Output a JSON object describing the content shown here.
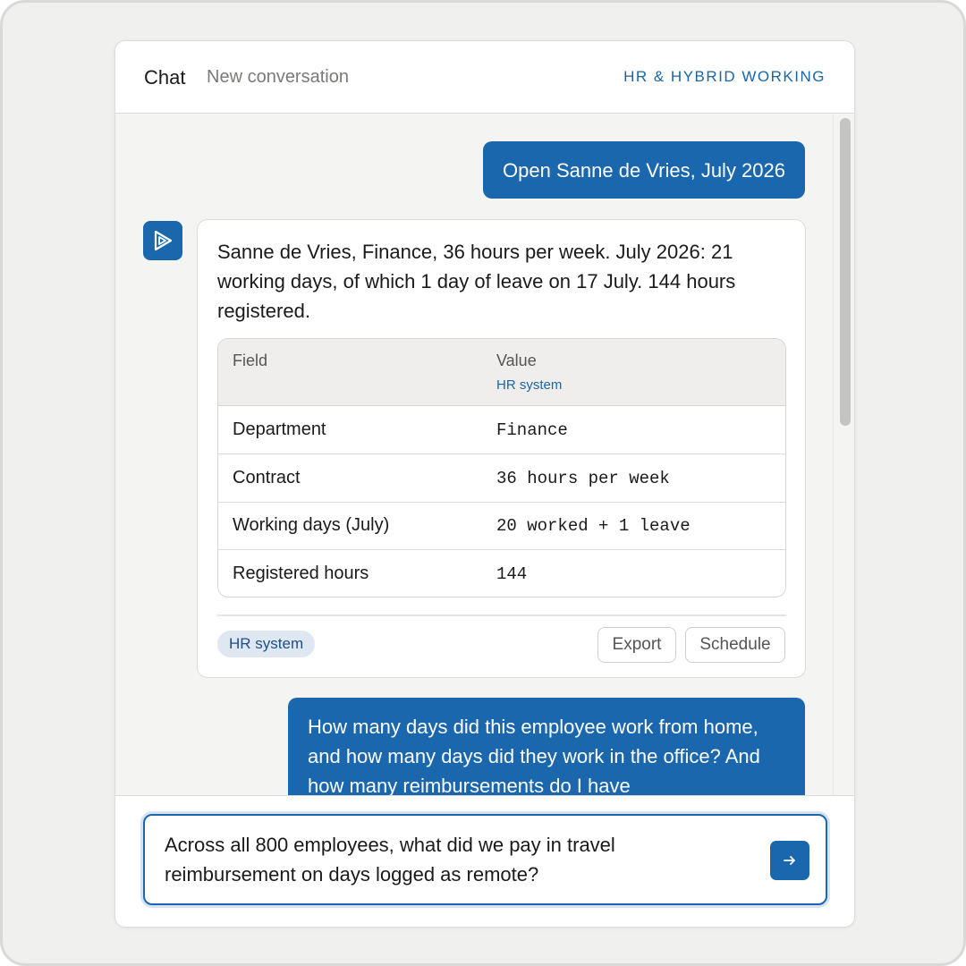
{
  "header": {
    "title": "Chat",
    "subtitle": "New conversation",
    "tag": "HR & HYBRID WORKING"
  },
  "messages": {
    "user1": "Open Sanne de Vries, July 2026",
    "assistant": {
      "text": "Sanne de Vries, Finance, 36 hours per week. July 2026: 21 working days, of which 1 day of leave on 17 July. 144 hours registered.",
      "table": {
        "col_field": "Field",
        "col_value": "Value",
        "col_value_source": "HR system",
        "rows": [
          {
            "field": "Department",
            "value": "Finance"
          },
          {
            "field": "Contract",
            "value": "36 hours per week"
          },
          {
            "field": "Working days (July)",
            "value": "20 worked + 1 leave"
          },
          {
            "field": "Registered hours",
            "value": "144"
          }
        ]
      },
      "source_chip": "HR system",
      "actions": {
        "export": "Export",
        "schedule": "Schedule"
      }
    },
    "user2": "How many days did this employee work from home, and how many days did they work in the office? And how many reimbursements do I have"
  },
  "composer": {
    "value": "Across all 800 employees, what did we pay in travel reimbursement on days logged as remote?",
    "send_icon": "arrow-right-icon"
  },
  "colors": {
    "accent": "#1a67ad",
    "tag_text": "#1a65a8",
    "chip_bg": "#dfe7f3"
  }
}
